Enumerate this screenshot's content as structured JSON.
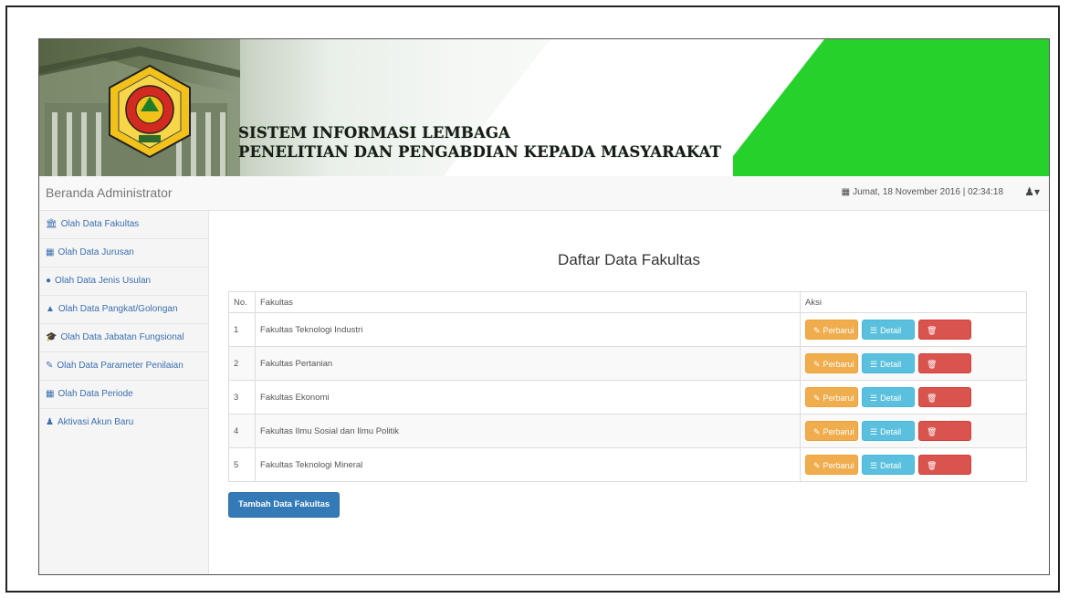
{
  "header": {
    "title_line1": "SISTEM INFORMASI LEMBAGA",
    "title_line2": "PENELITIAN DAN PENGABDIAN KEPADA MASYARAKAT"
  },
  "topbar": {
    "brand": "Beranda Administrator",
    "datetime": "Jumat, 18 November 2016 | 02:34:18",
    "user_icon": "user-icon",
    "user_caret": "▾"
  },
  "sidebar": {
    "items": [
      {
        "icon": "bank-icon",
        "glyph": "🏛",
        "label": "Olah Data Fakultas"
      },
      {
        "icon": "building-icon",
        "glyph": "▦",
        "label": "Olah Data Jurusan"
      },
      {
        "icon": "pin-icon",
        "glyph": "●",
        "label": "Olah Data Jenis Usulan"
      },
      {
        "icon": "grade-icon",
        "glyph": "▲",
        "label": "Olah Data Pangkat/Golongan"
      },
      {
        "icon": "graduation-cap-icon",
        "glyph": "🎓",
        "label": "Olah Data Jabatan Fungsional"
      },
      {
        "icon": "pencil-icon",
        "glyph": "✎",
        "label": "Olah Data Parameter Penilaian"
      },
      {
        "icon": "calendar-icon",
        "glyph": "▦",
        "label": "Olah Data Periode"
      },
      {
        "icon": "user-icon",
        "glyph": "♟",
        "label": "Aktivasi Akun Baru"
      }
    ]
  },
  "main": {
    "page_title": "Daftar Data Fakultas",
    "table": {
      "headers": [
        "No.",
        "Fakultas",
        "Aksi"
      ],
      "rows": [
        {
          "no": "1",
          "fakultas": "Fakultas Teknologi Industri"
        },
        {
          "no": "2",
          "fakultas": "Fakultas Pertanian"
        },
        {
          "no": "3",
          "fakultas": "Fakultas Ekonomi"
        },
        {
          "no": "4",
          "fakultas": "Fakultas Ilmu Sosial dan Ilmu Politik"
        },
        {
          "no": "5",
          "fakultas": "Fakultas Teknologi Mineral"
        }
      ],
      "actions": {
        "edit": "Perbarui",
        "detail": "Detail",
        "delete": "Hapus"
      }
    },
    "add_button": "Tambah Data Fakultas"
  },
  "colors": {
    "banner_green": "#27d12c",
    "btn_edit": "#f0ad4e",
    "btn_detail": "#5bc0de",
    "btn_delete": "#d9534f",
    "btn_primary": "#337ab7"
  }
}
